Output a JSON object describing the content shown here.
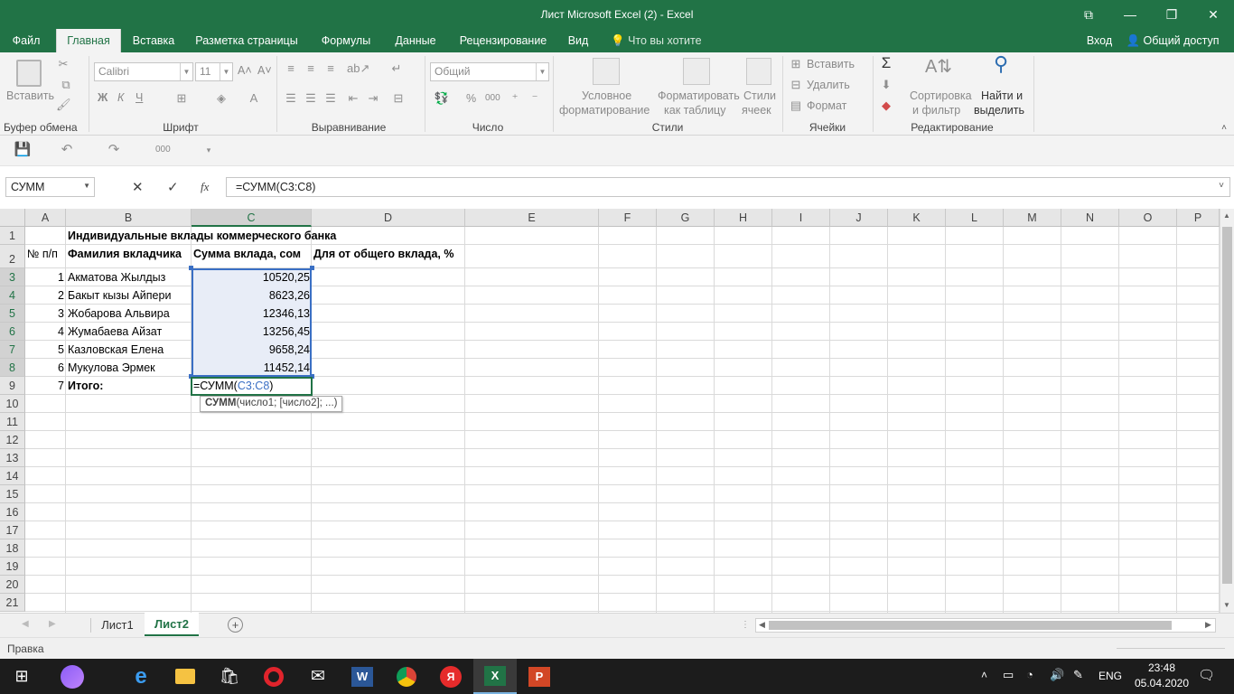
{
  "window": {
    "title": "Лист Microsoft Excel (2) - Excel",
    "controls": {
      "ribbon_display": "⧉",
      "minimize": "—",
      "maximize": "❐",
      "close": "✕"
    }
  },
  "tabs": [
    "Файл",
    "Главная",
    "Вставка",
    "Разметка страницы",
    "Формулы",
    "Данные",
    "Рецензирование",
    "Вид"
  ],
  "active_tab": "Главная",
  "tell_me": "Что вы хотите сделать?",
  "signin": "Вход",
  "share": "Общий доступ",
  "ribbon": {
    "clipboard": {
      "paste": "Вставить",
      "label": "Буфер обмена"
    },
    "font": {
      "name": "Calibri",
      "size": "11",
      "bold": "Ж",
      "italic": "К",
      "underline": "Ч",
      "grow": "A˄",
      "shrink": "A˅",
      "label": "Шрифт"
    },
    "alignment": {
      "label": "Выравнивание"
    },
    "number": {
      "format": "Общий",
      "percent": "%",
      "thousands": "000",
      "label": "Число"
    },
    "styles": {
      "conditional_1": "Условное",
      "conditional_2": "форматирование",
      "table_1": "Форматировать",
      "table_2": "как таблицу",
      "cell_1": "Стили",
      "cell_2": "ячеек",
      "label": "Стили"
    },
    "cells": {
      "insert": "Вставить",
      "delete": "Удалить",
      "format": "Формат",
      "label": "Ячейки"
    },
    "editing": {
      "sort_1": "Сортировка",
      "sort_2": "и фильтр",
      "find_1": "Найти и",
      "find_2": "выделить",
      "label": "Редактирование"
    }
  },
  "qat": {
    "thousands": "000"
  },
  "formula_bar": {
    "name_box": "СУММ",
    "cancel": "✕",
    "enter": "✓",
    "fx": "fx",
    "formula": "=СУММ(C3:C8)"
  },
  "columns": [
    "A",
    "B",
    "C",
    "D",
    "E",
    "F",
    "G",
    "H",
    "I",
    "J",
    "K",
    "L",
    "M",
    "N",
    "O",
    "P"
  ],
  "rows": [
    "1",
    "2",
    "3",
    "4",
    "5",
    "6",
    "7",
    "8",
    "9",
    "10",
    "11",
    "12",
    "13",
    "14",
    "15",
    "16",
    "17",
    "18",
    "19",
    "20",
    "21"
  ],
  "sheet": {
    "title": "Индивидуальные вклады коммерческого банка",
    "headers": {
      "a": "№ п/п",
      "b": "Фамилия вкладчика",
      "c": "Сумма вклада, сом",
      "d": "Для от общего вклада, %"
    },
    "data": [
      {
        "n": "1",
        "name": "Акматова Жылдыз",
        "sum": "10520,25"
      },
      {
        "n": "2",
        "name": "Бакыт кызы Айпери",
        "sum": "8623,26"
      },
      {
        "n": "3",
        "name": "Жобарова Альвира",
        "sum": "12346,13"
      },
      {
        "n": "4",
        "name": "Жумабаева Айзат",
        "sum": "13256,45"
      },
      {
        "n": "5",
        "name": "Казловская Елена",
        "sum": "9658,24"
      },
      {
        "n": "6",
        "name": "Мукулова Эрмек",
        "sum": "11452,14"
      }
    ],
    "total": {
      "n": "7",
      "label": "Итого:",
      "edit_prefix": "=СУММ(",
      "edit_ref": "C3:C8",
      "edit_suffix": ")"
    },
    "tooltip": {
      "fn": "СУММ",
      "args": "(число1; [число2]; ...)"
    }
  },
  "sheet_tabs": [
    "Лист1",
    "Лист2"
  ],
  "active_sheet": "Лист2",
  "status": {
    "mode": "Правка"
  },
  "taskbar": {
    "lang": "ENG",
    "time": "23:48",
    "date": "05.04.2020"
  },
  "colors": {
    "excel_green": "#217346",
    "ref_blue": "#3a6fc4",
    "selection_fill": "#e8edf7"
  }
}
